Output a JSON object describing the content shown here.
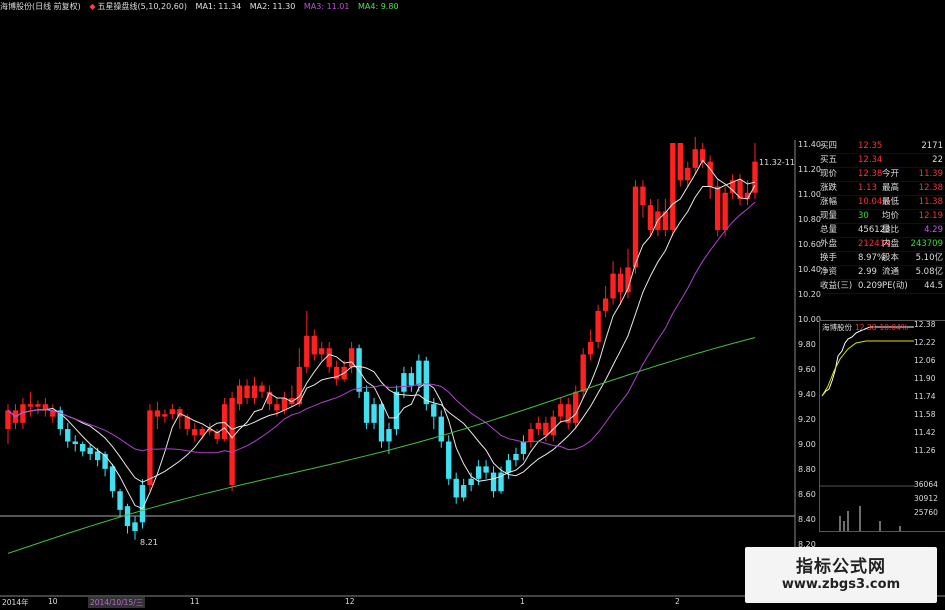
{
  "header": {
    "stock_title": "海博股份(日线 前复权)",
    "indicator_name": "五星操盘线(5,10,20,60)",
    "ma1": "MA1: 11.34",
    "ma2": "MA2: 11.30",
    "ma3": "MA3: 11.01",
    "ma4": "MA4: 9.80"
  },
  "price_scale": [
    "11.40",
    "11.20",
    "11.00",
    "10.80",
    "10.60",
    "10.40",
    "10.20",
    "10.00",
    "9.80",
    "9.60",
    "9.40",
    "9.20",
    "9.00",
    "8.80",
    "8.60",
    "8.40",
    "8.20"
  ],
  "annotations": {
    "low_marker": "8.21",
    "high_marker": "11.32-11"
  },
  "quote_panel": [
    {
      "l1": "买四",
      "v1": "12.35",
      "v1c": "red",
      "l2": "",
      "v2": "2171",
      "v2c": "white"
    },
    {
      "l1": "买五",
      "v1": "12.34",
      "v1c": "red",
      "l2": "",
      "v2": "22",
      "v2c": "white"
    },
    {
      "l1": "现价",
      "v1": "12.38",
      "v1c": "red",
      "l2": "今开",
      "v2": "11.39",
      "v2c": "red"
    },
    {
      "l1": "涨跌",
      "v1": "1.13",
      "v1c": "red",
      "l2": "最高",
      "v2": "12.38",
      "v2c": "red"
    },
    {
      "l1": "涨幅",
      "v1": "10.04%",
      "v1c": "red",
      "l2": "最低",
      "v2": "11.38",
      "v2c": "red"
    },
    {
      "l1": "现量",
      "v1": "30",
      "v1c": "green",
      "l2": "均价",
      "v2": "12.19",
      "v2c": "red"
    },
    {
      "l1": "总量",
      "v1": "456123",
      "v1c": "white",
      "l2": "量比",
      "v2": "4.29",
      "v2c": "purple"
    },
    {
      "l1": "外盘",
      "v1": "212414",
      "v1c": "red",
      "l2": "内盘",
      "v2": "243709",
      "v2c": "green"
    },
    {
      "l1": "换手",
      "v1": "8.97%",
      "v1c": "white",
      "l2": "股本",
      "v2": "5.10亿",
      "v2c": "white"
    },
    {
      "l1": "净资",
      "v1": "2.99",
      "v1c": "white",
      "l2": "流通",
      "v2": "5.08亿",
      "v2c": "white"
    },
    {
      "l1": "收益(三)",
      "v1": "0.209",
      "v1c": "white",
      "l2": "PE(动)",
      "v2": "44.5",
      "v2c": "white"
    }
  ],
  "mini_chart": {
    "name": "海博股份",
    "price": "12.38",
    "change": "10.04%",
    "scale": [
      "12.38",
      "12.22",
      "12.06",
      "11.90",
      "11.74",
      "11.58",
      "11.42",
      "11.26",
      "36064",
      "30912",
      "25760"
    ]
  },
  "time_axis": [
    "2014年",
    "10",
    "2014/10/15/三",
    "11",
    "12",
    "1",
    "2"
  ],
  "watermark": {
    "title": "指标公式网",
    "url": "www.zbgs3.com"
  },
  "colors": {
    "up": "#ff2020",
    "down": "#40e0f0",
    "ma_white": "#e8e8e8",
    "ma_purple": "#b040d0",
    "ma_green": "#40c040"
  },
  "candles": [
    [
      9.1,
      9.25,
      9.3,
      8.98,
      1
    ],
    [
      9.25,
      9.15,
      9.3,
      9.1,
      1
    ],
    [
      9.15,
      9.3,
      9.35,
      9.1,
      1
    ],
    [
      9.3,
      9.28,
      9.4,
      9.2,
      1
    ],
    [
      9.28,
      9.3,
      9.33,
      9.22,
      1
    ],
    [
      9.3,
      9.25,
      9.35,
      9.2,
      1
    ],
    [
      9.25,
      9.2,
      9.3,
      9.15,
      1
    ],
    [
      9.25,
      9.1,
      9.28,
      9.05,
      0
    ],
    [
      9.1,
      9.0,
      9.15,
      8.95,
      0
    ],
    [
      9.0,
      8.98,
      9.05,
      8.92,
      0
    ],
    [
      8.98,
      8.92,
      9.0,
      8.88,
      0
    ],
    [
      8.95,
      8.9,
      8.98,
      8.85,
      0
    ],
    [
      8.92,
      8.85,
      8.95,
      8.8,
      0
    ],
    [
      8.9,
      8.78,
      8.92,
      8.72,
      0
    ],
    [
      8.8,
      8.6,
      8.82,
      8.55,
      0
    ],
    [
      8.6,
      8.45,
      8.62,
      8.4,
      0
    ],
    [
      8.48,
      8.32,
      8.5,
      8.26,
      0
    ],
    [
      8.35,
      8.28,
      8.4,
      8.21,
      0
    ],
    [
      8.35,
      8.65,
      8.7,
      8.3,
      0
    ],
    [
      8.65,
      9.25,
      9.3,
      8.6,
      1
    ],
    [
      9.25,
      9.2,
      9.32,
      9.1,
      1
    ],
    [
      9.2,
      9.22,
      9.26,
      9.15,
      1
    ],
    [
      9.22,
      9.26,
      9.3,
      9.18,
      1
    ],
    [
      9.26,
      9.2,
      9.28,
      9.1,
      1
    ],
    [
      9.2,
      9.1,
      9.22,
      9.05,
      1
    ],
    [
      9.1,
      9.05,
      9.15,
      9.0,
      1
    ],
    [
      9.05,
      9.1,
      9.12,
      9.02,
      1
    ],
    [
      9.1,
      9.08,
      9.15,
      9.05,
      1
    ],
    [
      9.08,
      9.02,
      9.1,
      8.98,
      1
    ],
    [
      9.02,
      9.3,
      9.35,
      9.0,
      1
    ],
    [
      9.35,
      8.65,
      9.4,
      8.6,
      1
    ],
    [
      9.3,
      9.45,
      9.5,
      9.25,
      1
    ],
    [
      9.45,
      9.35,
      9.5,
      9.3,
      1
    ],
    [
      9.35,
      9.45,
      9.52,
      9.3,
      1
    ],
    [
      9.45,
      9.4,
      9.48,
      9.35,
      1
    ],
    [
      9.4,
      9.3,
      9.45,
      9.25,
      1
    ],
    [
      9.3,
      9.25,
      9.35,
      9.2,
      1
    ],
    [
      9.25,
      9.35,
      9.4,
      9.22,
      1
    ],
    [
      9.35,
      9.3,
      9.45,
      9.28,
      1
    ],
    [
      9.3,
      9.6,
      9.75,
      9.28,
      1
    ],
    [
      9.6,
      9.85,
      10.05,
      9.55,
      1
    ],
    [
      9.85,
      9.7,
      9.9,
      9.65,
      1
    ],
    [
      9.7,
      9.75,
      9.8,
      9.65,
      1
    ],
    [
      9.75,
      9.6,
      9.8,
      9.55,
      1
    ],
    [
      9.6,
      9.5,
      9.65,
      9.45,
      1
    ],
    [
      9.5,
      9.6,
      9.65,
      9.48,
      1
    ],
    [
      9.6,
      9.75,
      9.8,
      9.55,
      1
    ],
    [
      9.75,
      9.4,
      9.78,
      9.35,
      0
    ],
    [
      9.4,
      9.15,
      9.45,
      9.1,
      0
    ],
    [
      9.15,
      9.3,
      9.35,
      9.1,
      0
    ],
    [
      9.3,
      9.0,
      9.32,
      8.95,
      0
    ],
    [
      9.0,
      9.1,
      9.15,
      8.9,
      0
    ],
    [
      9.1,
      9.4,
      9.45,
      9.05,
      0
    ],
    [
      9.4,
      9.55,
      9.6,
      9.35,
      0
    ],
    [
      9.55,
      9.45,
      9.6,
      9.4,
      0
    ],
    [
      9.45,
      9.65,
      9.7,
      9.4,
      0
    ],
    [
      9.65,
      9.3,
      9.68,
      9.25,
      0
    ],
    [
      9.3,
      9.2,
      9.35,
      9.1,
      0
    ],
    [
      9.2,
      9.0,
      9.25,
      8.95,
      0
    ],
    [
      9.0,
      8.7,
      9.05,
      8.65,
      0
    ],
    [
      8.7,
      8.55,
      8.75,
      8.5,
      0
    ],
    [
      8.55,
      8.65,
      8.7,
      8.52,
      0
    ],
    [
      8.65,
      8.7,
      8.75,
      8.6,
      0
    ],
    [
      8.7,
      8.8,
      8.85,
      8.65,
      0
    ],
    [
      8.8,
      8.75,
      8.85,
      8.7,
      0
    ],
    [
      8.75,
      8.6,
      8.8,
      8.55,
      0
    ],
    [
      8.6,
      8.75,
      8.8,
      8.58,
      0
    ],
    [
      8.75,
      8.85,
      8.9,
      8.7,
      0
    ],
    [
      8.85,
      8.9,
      8.95,
      8.8,
      0
    ],
    [
      8.9,
      9.0,
      9.05,
      8.85,
      0
    ],
    [
      9.0,
      9.1,
      9.15,
      8.95,
      1
    ],
    [
      9.1,
      9.15,
      9.2,
      9.05,
      1
    ],
    [
      9.15,
      9.05,
      9.2,
      9.0,
      1
    ],
    [
      9.05,
      9.2,
      9.25,
      9.0,
      1
    ],
    [
      9.2,
      9.3,
      9.35,
      9.15,
      1
    ],
    [
      9.3,
      9.15,
      9.35,
      9.1,
      1
    ],
    [
      9.15,
      9.4,
      9.45,
      9.1,
      1
    ],
    [
      9.4,
      9.7,
      9.75,
      9.35,
      1
    ],
    [
      9.7,
      9.8,
      9.9,
      9.65,
      1
    ],
    [
      9.8,
      10.05,
      10.1,
      9.75,
      1
    ],
    [
      10.05,
      10.15,
      10.25,
      10.0,
      1
    ],
    [
      10.15,
      10.35,
      10.45,
      10.1,
      1
    ],
    [
      10.35,
      10.2,
      10.4,
      10.1,
      1
    ],
    [
      10.2,
      10.4,
      10.55,
      10.15,
      1
    ],
    [
      10.4,
      11.05,
      11.1,
      10.35,
      1
    ],
    [
      11.05,
      10.9,
      11.1,
      10.8,
      1
    ],
    [
      10.9,
      10.7,
      10.95,
      10.65,
      1
    ],
    [
      10.7,
      10.85,
      10.95,
      10.65,
      1
    ],
    [
      10.85,
      10.7,
      10.95,
      10.65,
      1
    ],
    [
      10.7,
      11.4,
      11.4,
      10.65,
      1
    ],
    [
      11.4,
      11.1,
      11.4,
      11.05,
      1
    ],
    [
      11.1,
      11.2,
      11.25,
      11.05,
      1
    ],
    [
      11.2,
      11.35,
      11.45,
      11.15,
      1
    ],
    [
      11.35,
      11.25,
      11.4,
      11.2,
      1
    ],
    [
      11.25,
      11.05,
      11.3,
      10.95,
      1
    ],
    [
      11.05,
      10.7,
      11.1,
      10.65,
      1
    ],
    [
      10.7,
      11.0,
      11.05,
      10.65,
      1
    ],
    [
      11.0,
      11.1,
      11.15,
      10.95,
      1
    ],
    [
      11.1,
      10.95,
      11.15,
      10.9,
      1
    ],
    [
      10.95,
      11.0,
      11.1,
      10.9,
      1
    ],
    [
      11.0,
      11.25,
      11.4,
      10.95,
      1
    ]
  ]
}
